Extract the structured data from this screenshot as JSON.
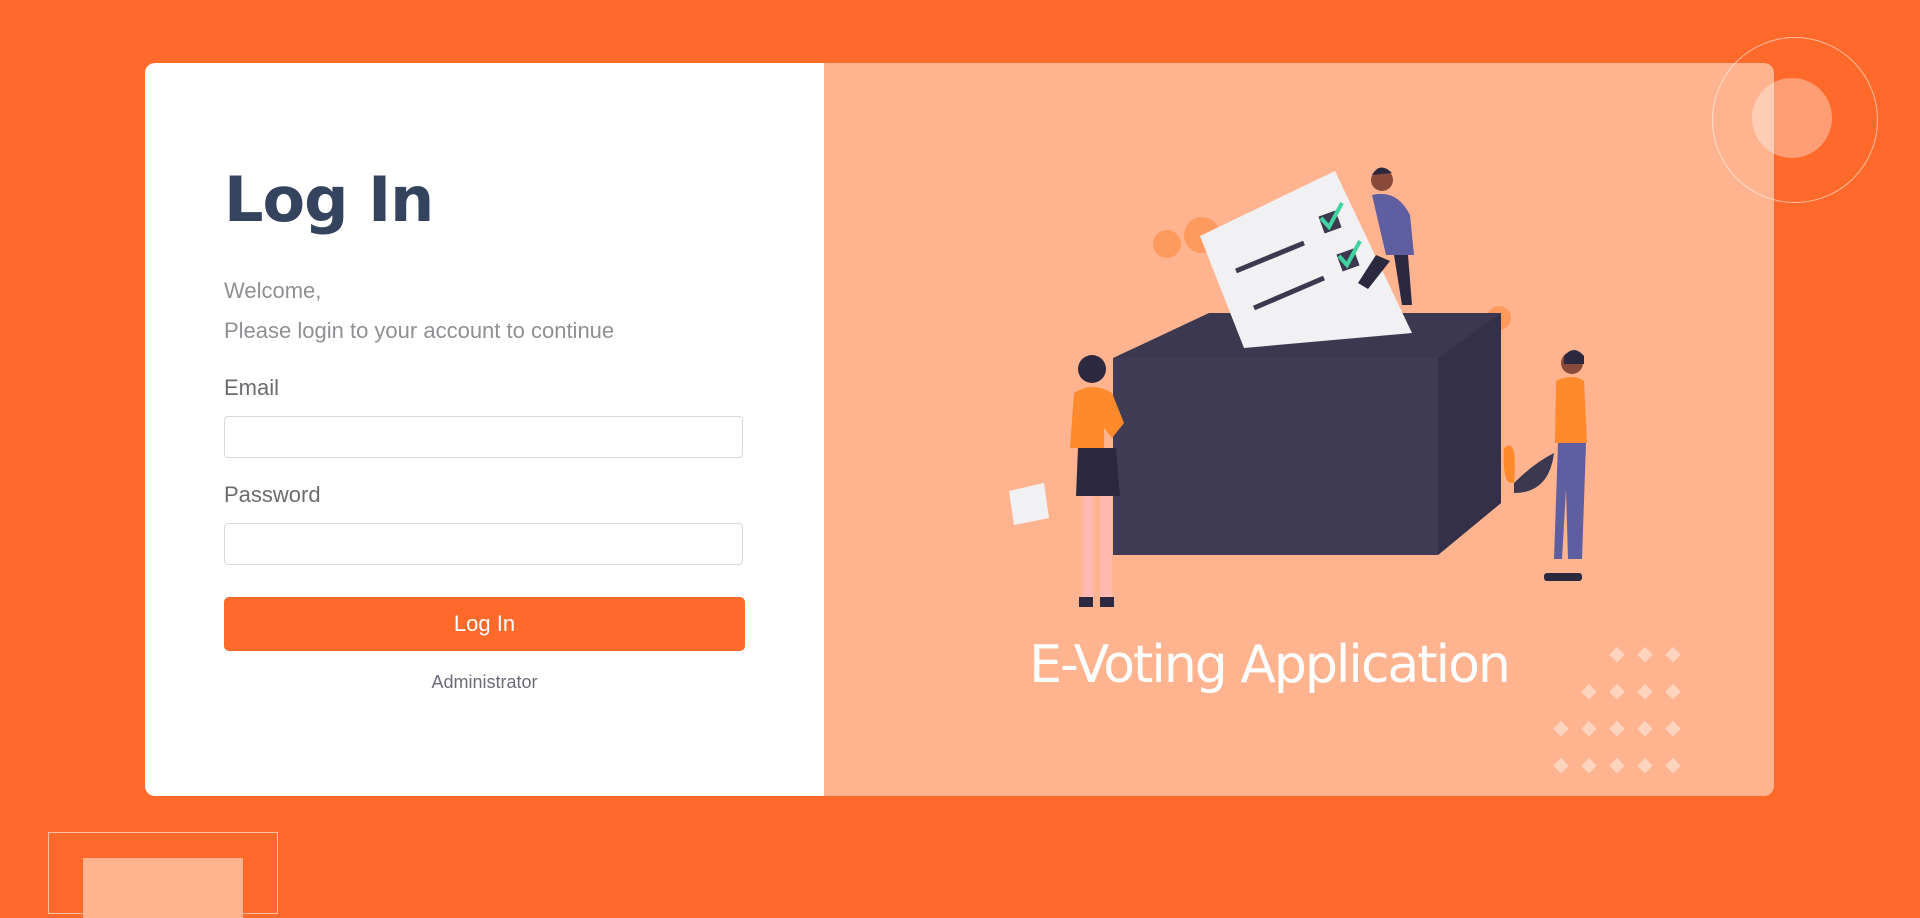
{
  "login": {
    "title": "Log In",
    "welcome_line1": "Welcome,",
    "welcome_line2": "Please login to your account to continue",
    "email_label": "Email",
    "email_value": "",
    "password_label": "Password",
    "password_value": "",
    "submit_label": "Log In",
    "admin_link": "Administrator"
  },
  "hero": {
    "app_title": "E-Voting Application",
    "illustration_icon": "voting-ballot-box-illustration"
  },
  "colors": {
    "background": "#ff6a2b",
    "panel_right": "#ffb38f",
    "title": "#34435e",
    "button": "#ff6a2b"
  }
}
